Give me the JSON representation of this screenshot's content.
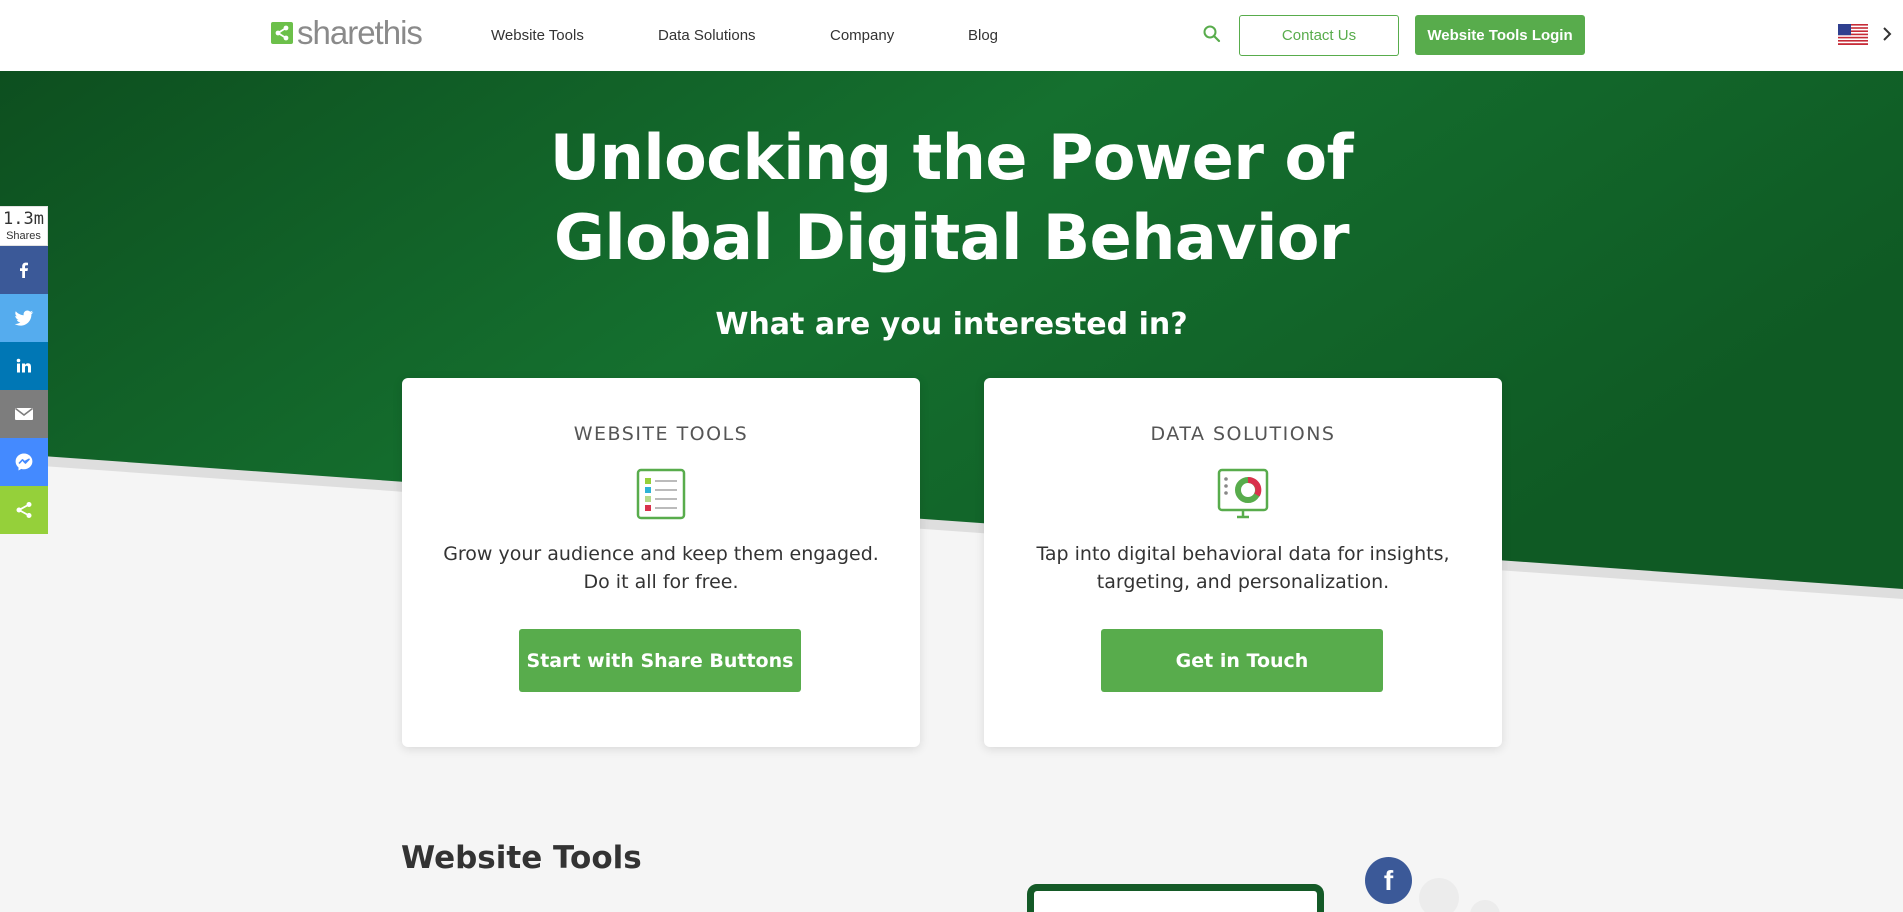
{
  "brand": {
    "name": "sharethis",
    "logo_color": "#6cc04a"
  },
  "nav": {
    "items": [
      {
        "label": "Website Tools"
      },
      {
        "label": "Data Solutions"
      },
      {
        "label": "Company"
      },
      {
        "label": "Blog"
      }
    ],
    "search_icon": "search-icon",
    "contact_label": "Contact Us",
    "login_label": "Website Tools Login",
    "locale_icon": "us-flag-icon"
  },
  "hero": {
    "title_line1": "Unlocking the Power of",
    "title_line2": "Global Digital Behavior",
    "subtitle": "What are you interested in?",
    "bg_color": "#0f5a24"
  },
  "cards": [
    {
      "title": "WEBSITE TOOLS",
      "icon": "list-document-icon",
      "desc_line1": "Grow your audience and keep them engaged.",
      "desc_line2": "Do it all for free.",
      "button": "Start with Share Buttons"
    },
    {
      "title": "DATA SOLUTIONS",
      "icon": "donut-chart-monitor-icon",
      "desc_line1": "Tap into digital behavioral data for insights,",
      "desc_line2": "targeting, and personalization.",
      "button": "Get in Touch"
    }
  ],
  "share_bar": {
    "count": "1.3m",
    "count_label": "Shares",
    "buttons": [
      {
        "icon": "facebook-icon",
        "color": "#3b5998"
      },
      {
        "icon": "twitter-icon",
        "color": "#55acee"
      },
      {
        "icon": "linkedin-icon",
        "color": "#0077b5"
      },
      {
        "icon": "email-icon",
        "color": "#7d7d7d"
      },
      {
        "icon": "messenger-icon",
        "color": "#448aff"
      },
      {
        "icon": "sharethis-icon",
        "color": "#95d03a"
      }
    ]
  },
  "section": {
    "heading": "Website Tools"
  },
  "colors": {
    "accent": "#58ac4c",
    "hero_dark": "#0d4f1f",
    "hero_light": "#15702f"
  }
}
